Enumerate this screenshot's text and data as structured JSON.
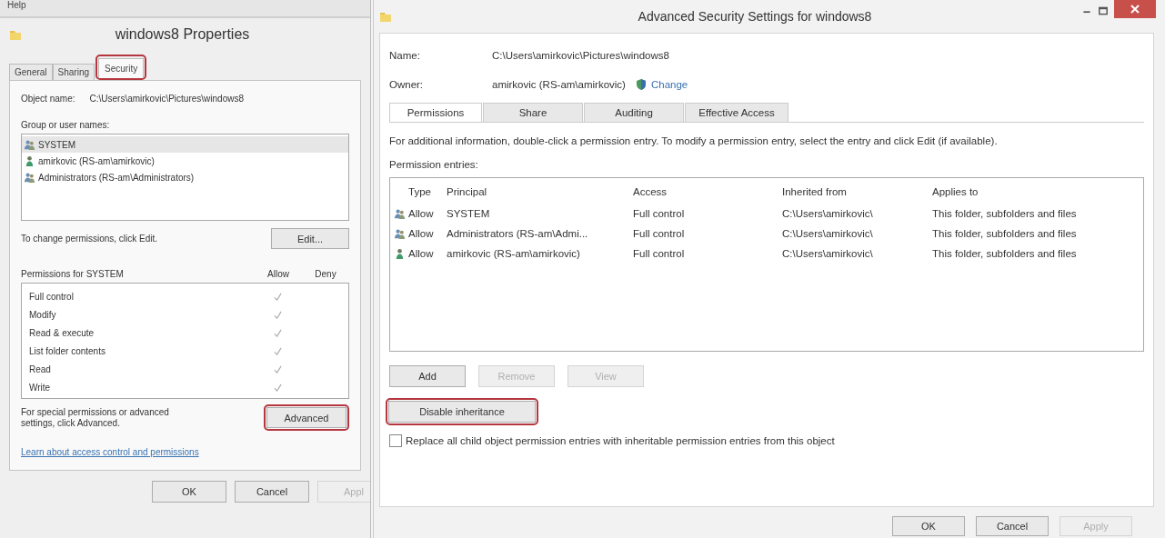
{
  "properties_window": {
    "menu": "Help",
    "title": "windows8 Properties",
    "tabs": [
      {
        "label": "General",
        "selected": false,
        "highlighted": false
      },
      {
        "label": "Sharing",
        "selected": false,
        "highlighted": false
      },
      {
        "label": "Security",
        "selected": true,
        "highlighted": true
      }
    ],
    "object_name_label": "Object name:",
    "object_name": "C:\\Users\\amirkovic\\Pictures\\windows8",
    "group_label": "Group or user names:",
    "groups": [
      {
        "name": "SYSTEM",
        "kind": "group",
        "selected": true
      },
      {
        "name": "amirkovic (RS-am\\amirkovic)",
        "kind": "user",
        "selected": false
      },
      {
        "name": "Administrators (RS-am\\Administrators)",
        "kind": "group",
        "selected": false
      }
    ],
    "change_hint": "To change permissions, click Edit.",
    "edit_button": "Edit...",
    "permissions_label": "Permissions for SYSTEM",
    "allow_header": "Allow",
    "deny_header": "Deny",
    "permissions": [
      {
        "name": "Full control",
        "allow": true,
        "deny": false
      },
      {
        "name": "Modify",
        "allow": true,
        "deny": false
      },
      {
        "name": "Read & execute",
        "allow": true,
        "deny": false
      },
      {
        "name": "List folder contents",
        "allow": true,
        "deny": false
      },
      {
        "name": "Read",
        "allow": true,
        "deny": false
      },
      {
        "name": "Write",
        "allow": true,
        "deny": false
      }
    ],
    "advanced_hint": "For special permissions or advanced settings, click Advanced.",
    "advanced_button": {
      "label": "Advanced",
      "highlighted": true
    },
    "learn_link": "Learn about access control and permissions",
    "buttons": [
      {
        "label": "OK",
        "disabled": false
      },
      {
        "label": "Cancel",
        "disabled": false
      },
      {
        "label": "Appl",
        "disabled": true
      }
    ]
  },
  "advanced_window": {
    "title": "Advanced Security Settings for windows8",
    "name_label": "Name:",
    "name": "C:\\Users\\amirkovic\\Pictures\\windows8",
    "owner_label": "Owner:",
    "owner": "amirkovic (RS-am\\amirkovic)",
    "change_link": "Change",
    "tabs": [
      {
        "label": "Permissions",
        "selected": true
      },
      {
        "label": "Share",
        "selected": false
      },
      {
        "label": "Auditing",
        "selected": false
      },
      {
        "label": "Effective Access",
        "selected": false
      }
    ],
    "info": "For additional information, double-click a permission entry. To modify a permission entry, select the entry and click Edit (if available).",
    "entries_label": "Permission entries:",
    "table": {
      "columns": [
        "Type",
        "Principal",
        "Access",
        "Inherited from",
        "Applies to"
      ],
      "rows": [
        {
          "kind": "group",
          "type": "Allow",
          "principal": "SYSTEM",
          "access": "Full control",
          "inherited_from": "C:\\Users\\amirkovic\\",
          "applies_to": "This folder, subfolders and files"
        },
        {
          "kind": "group",
          "type": "Allow",
          "principal": "Administrators (RS-am\\Admi...",
          "access": "Full control",
          "inherited_from": "C:\\Users\\amirkovic\\",
          "applies_to": "This folder, subfolders and files"
        },
        {
          "kind": "user",
          "type": "Allow",
          "principal": "amirkovic (RS-am\\amirkovic)",
          "access": "Full control",
          "inherited_from": "C:\\Users\\amirkovic\\",
          "applies_to": "This folder, subfolders and files"
        }
      ]
    },
    "action_buttons": [
      {
        "label": "Add",
        "disabled": false
      },
      {
        "label": "Remove",
        "disabled": true
      },
      {
        "label": "View",
        "disabled": true
      }
    ],
    "inheritance_button": {
      "label": "Disable inheritance",
      "highlighted": true
    },
    "replace_checkbox": {
      "label": "Replace all child object permission entries with inheritable permission entries from this object",
      "checked": false
    },
    "buttons": [
      {
        "label": "OK",
        "disabled": false
      },
      {
        "label": "Cancel",
        "disabled": false
      },
      {
        "label": "Apply",
        "disabled": true
      }
    ]
  }
}
